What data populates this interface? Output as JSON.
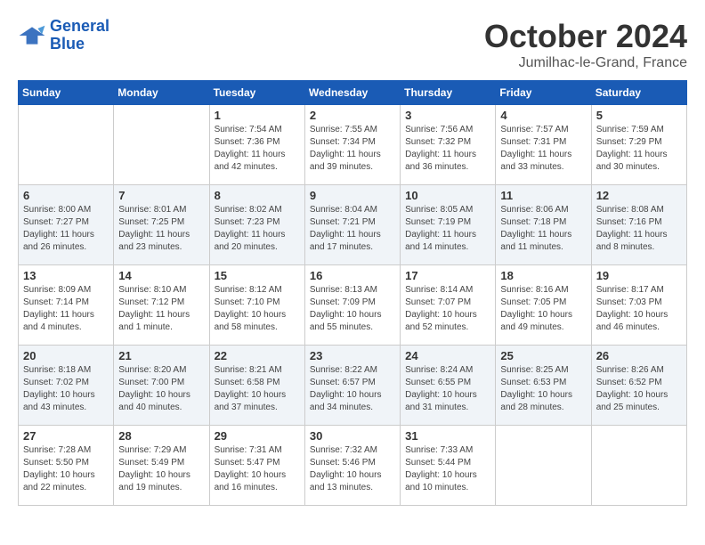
{
  "logo": {
    "line1": "General",
    "line2": "Blue"
  },
  "title": "October 2024",
  "location": "Jumilhac-le-Grand, France",
  "weekdays": [
    "Sunday",
    "Monday",
    "Tuesday",
    "Wednesday",
    "Thursday",
    "Friday",
    "Saturday"
  ],
  "weeks": [
    [
      {
        "day": "",
        "info": ""
      },
      {
        "day": "",
        "info": ""
      },
      {
        "day": "1",
        "info": "Sunrise: 7:54 AM\nSunset: 7:36 PM\nDaylight: 11 hours and 42 minutes."
      },
      {
        "day": "2",
        "info": "Sunrise: 7:55 AM\nSunset: 7:34 PM\nDaylight: 11 hours and 39 minutes."
      },
      {
        "day": "3",
        "info": "Sunrise: 7:56 AM\nSunset: 7:32 PM\nDaylight: 11 hours and 36 minutes."
      },
      {
        "day": "4",
        "info": "Sunrise: 7:57 AM\nSunset: 7:31 PM\nDaylight: 11 hours and 33 minutes."
      },
      {
        "day": "5",
        "info": "Sunrise: 7:59 AM\nSunset: 7:29 PM\nDaylight: 11 hours and 30 minutes."
      }
    ],
    [
      {
        "day": "6",
        "info": "Sunrise: 8:00 AM\nSunset: 7:27 PM\nDaylight: 11 hours and 26 minutes."
      },
      {
        "day": "7",
        "info": "Sunrise: 8:01 AM\nSunset: 7:25 PM\nDaylight: 11 hours and 23 minutes."
      },
      {
        "day": "8",
        "info": "Sunrise: 8:02 AM\nSunset: 7:23 PM\nDaylight: 11 hours and 20 minutes."
      },
      {
        "day": "9",
        "info": "Sunrise: 8:04 AM\nSunset: 7:21 PM\nDaylight: 11 hours and 17 minutes."
      },
      {
        "day": "10",
        "info": "Sunrise: 8:05 AM\nSunset: 7:19 PM\nDaylight: 11 hours and 14 minutes."
      },
      {
        "day": "11",
        "info": "Sunrise: 8:06 AM\nSunset: 7:18 PM\nDaylight: 11 hours and 11 minutes."
      },
      {
        "day": "12",
        "info": "Sunrise: 8:08 AM\nSunset: 7:16 PM\nDaylight: 11 hours and 8 minutes."
      }
    ],
    [
      {
        "day": "13",
        "info": "Sunrise: 8:09 AM\nSunset: 7:14 PM\nDaylight: 11 hours and 4 minutes."
      },
      {
        "day": "14",
        "info": "Sunrise: 8:10 AM\nSunset: 7:12 PM\nDaylight: 11 hours and 1 minute."
      },
      {
        "day": "15",
        "info": "Sunrise: 8:12 AM\nSunset: 7:10 PM\nDaylight: 10 hours and 58 minutes."
      },
      {
        "day": "16",
        "info": "Sunrise: 8:13 AM\nSunset: 7:09 PM\nDaylight: 10 hours and 55 minutes."
      },
      {
        "day": "17",
        "info": "Sunrise: 8:14 AM\nSunset: 7:07 PM\nDaylight: 10 hours and 52 minutes."
      },
      {
        "day": "18",
        "info": "Sunrise: 8:16 AM\nSunset: 7:05 PM\nDaylight: 10 hours and 49 minutes."
      },
      {
        "day": "19",
        "info": "Sunrise: 8:17 AM\nSunset: 7:03 PM\nDaylight: 10 hours and 46 minutes."
      }
    ],
    [
      {
        "day": "20",
        "info": "Sunrise: 8:18 AM\nSunset: 7:02 PM\nDaylight: 10 hours and 43 minutes."
      },
      {
        "day": "21",
        "info": "Sunrise: 8:20 AM\nSunset: 7:00 PM\nDaylight: 10 hours and 40 minutes."
      },
      {
        "day": "22",
        "info": "Sunrise: 8:21 AM\nSunset: 6:58 PM\nDaylight: 10 hours and 37 minutes."
      },
      {
        "day": "23",
        "info": "Sunrise: 8:22 AM\nSunset: 6:57 PM\nDaylight: 10 hours and 34 minutes."
      },
      {
        "day": "24",
        "info": "Sunrise: 8:24 AM\nSunset: 6:55 PM\nDaylight: 10 hours and 31 minutes."
      },
      {
        "day": "25",
        "info": "Sunrise: 8:25 AM\nSunset: 6:53 PM\nDaylight: 10 hours and 28 minutes."
      },
      {
        "day": "26",
        "info": "Sunrise: 8:26 AM\nSunset: 6:52 PM\nDaylight: 10 hours and 25 minutes."
      }
    ],
    [
      {
        "day": "27",
        "info": "Sunrise: 7:28 AM\nSunset: 5:50 PM\nDaylight: 10 hours and 22 minutes."
      },
      {
        "day": "28",
        "info": "Sunrise: 7:29 AM\nSunset: 5:49 PM\nDaylight: 10 hours and 19 minutes."
      },
      {
        "day": "29",
        "info": "Sunrise: 7:31 AM\nSunset: 5:47 PM\nDaylight: 10 hours and 16 minutes."
      },
      {
        "day": "30",
        "info": "Sunrise: 7:32 AM\nSunset: 5:46 PM\nDaylight: 10 hours and 13 minutes."
      },
      {
        "day": "31",
        "info": "Sunrise: 7:33 AM\nSunset: 5:44 PM\nDaylight: 10 hours and 10 minutes."
      },
      {
        "day": "",
        "info": ""
      },
      {
        "day": "",
        "info": ""
      }
    ]
  ]
}
